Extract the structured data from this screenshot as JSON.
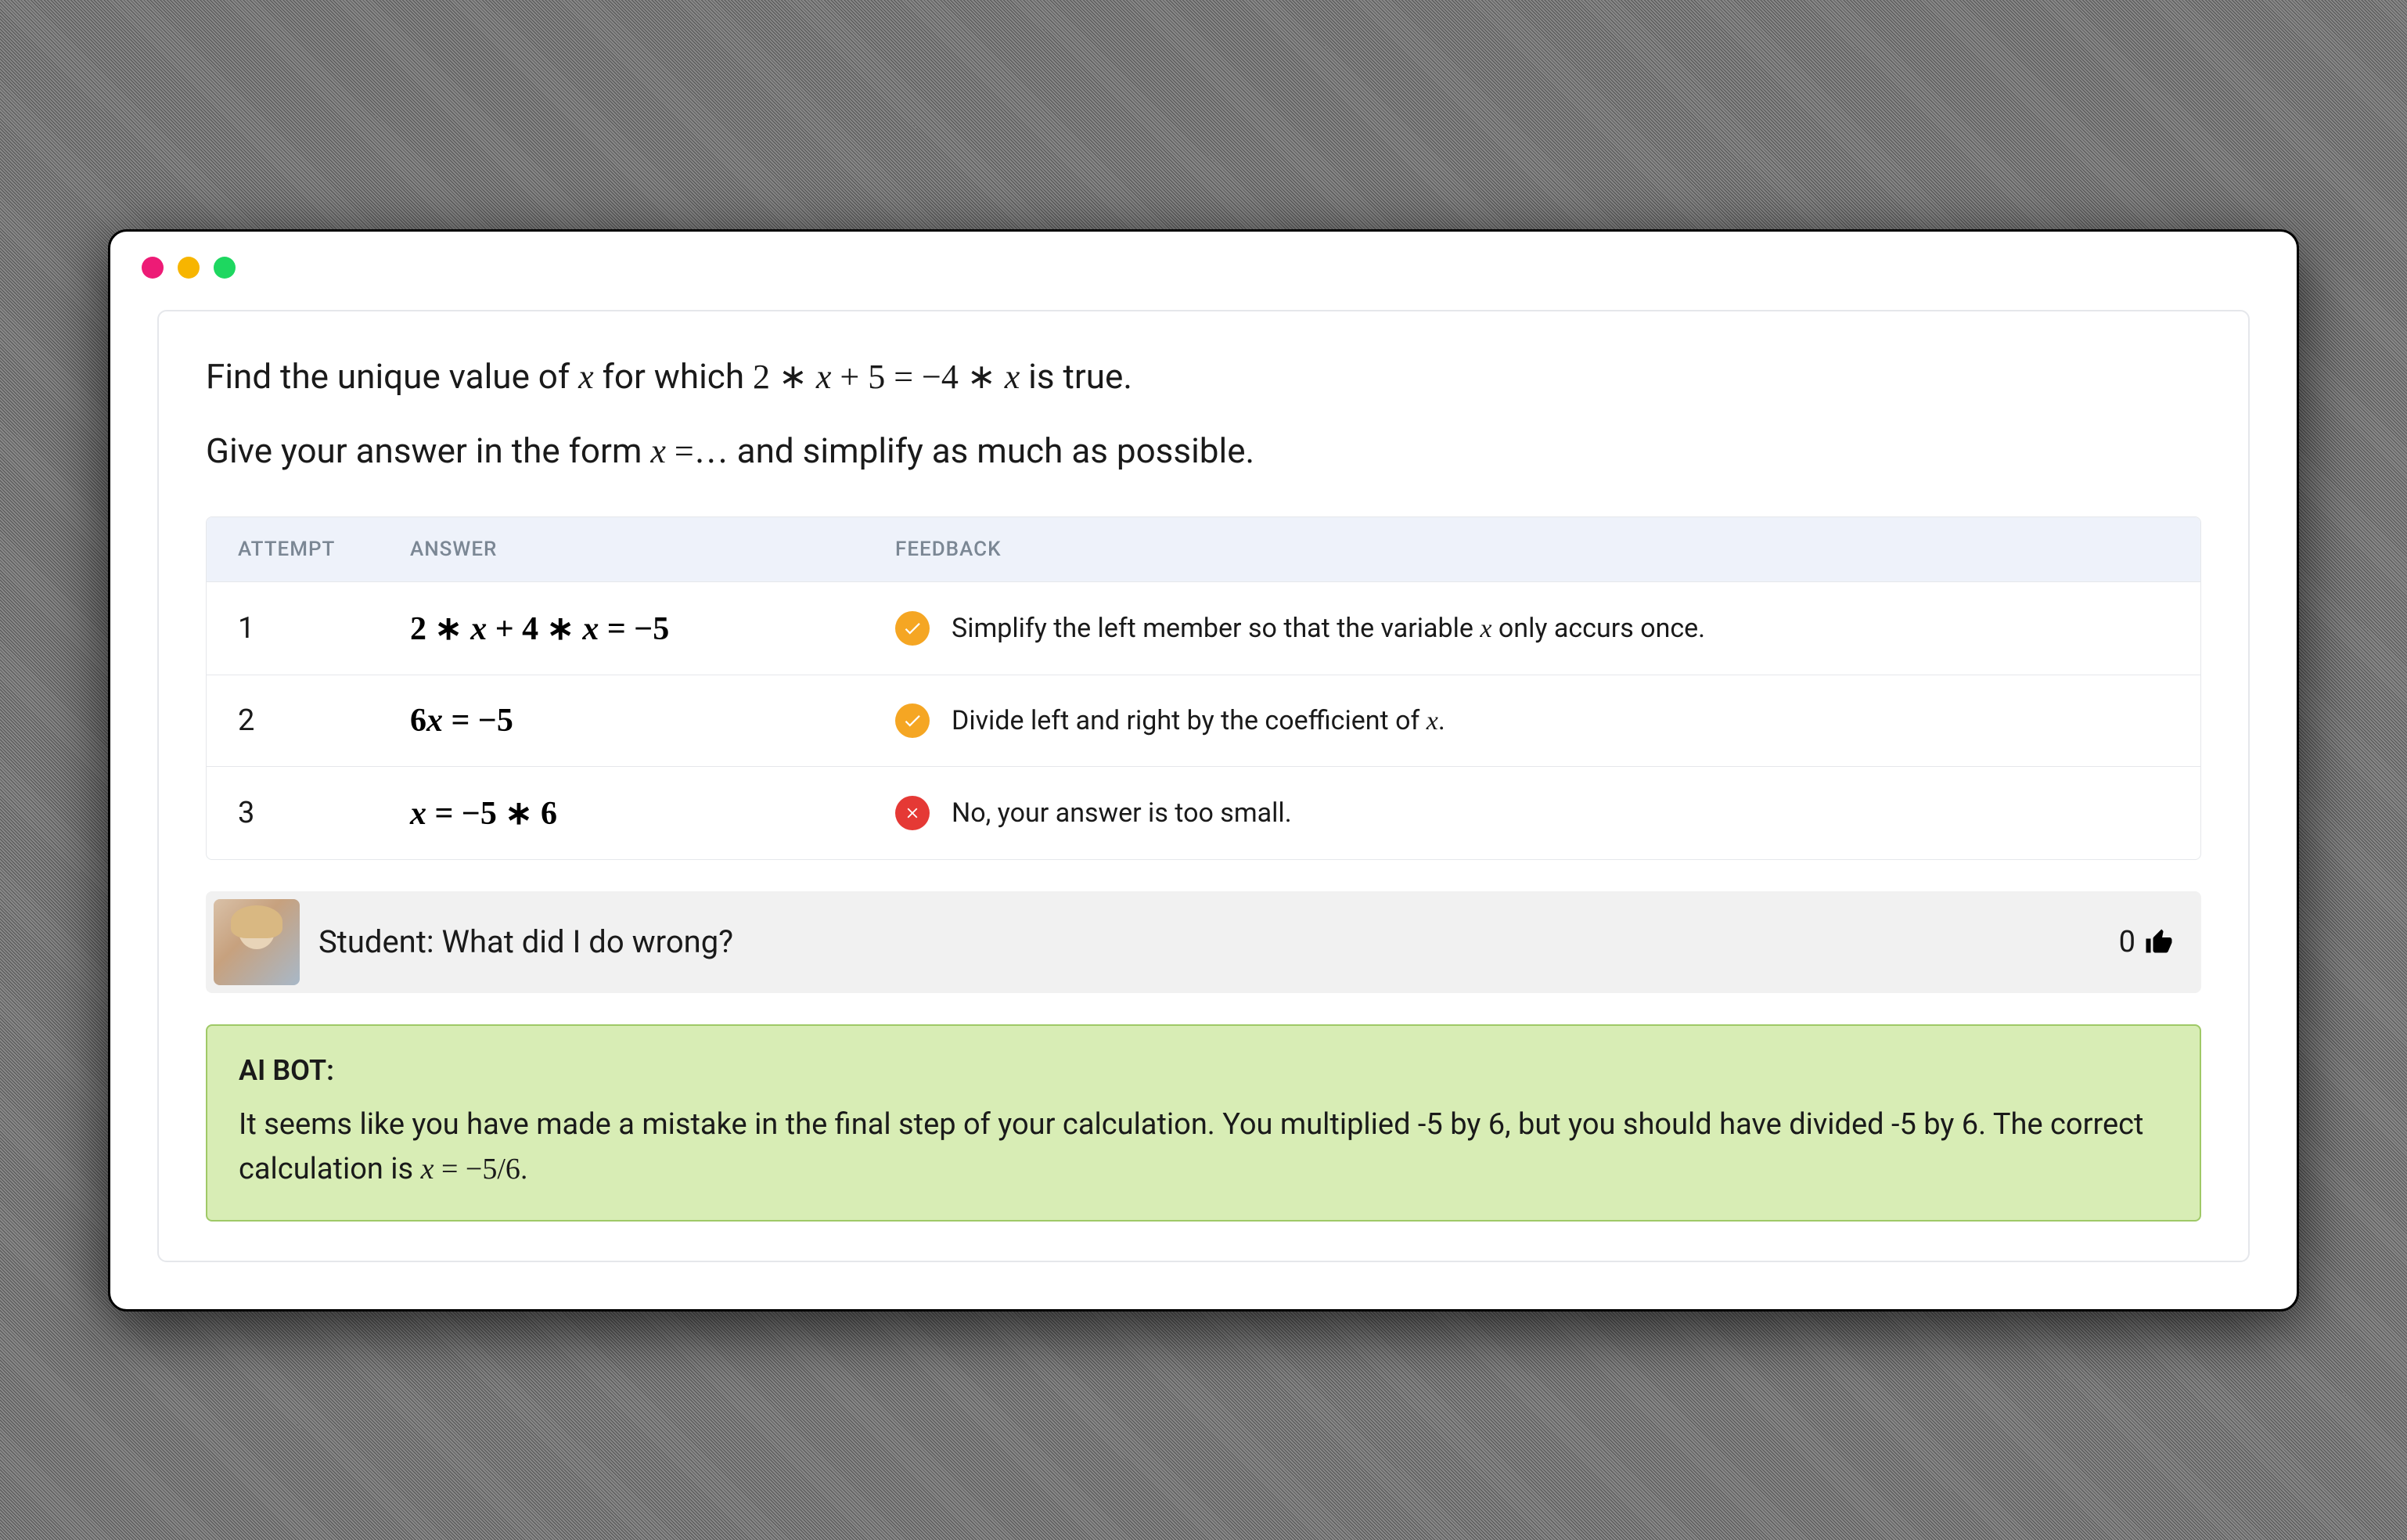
{
  "problem": {
    "line1_before": "Find the unique value of ",
    "line1_var": "x",
    "line1_mid": " for which ",
    "line1_equation": "2 ∗ x + 5 = −4 ∗ x",
    "line1_after": " is true.",
    "line2_before": "Give your answer in the form ",
    "line2_form": "x =…",
    "line2_after": " and simplify as much as possible."
  },
  "table": {
    "headers": {
      "attempt": "ATTEMPT",
      "answer": "ANSWER",
      "feedback": "FEEDBACK"
    },
    "rows": [
      {
        "num": "1",
        "answer": "2 ∗ x + 4 ∗ x = −5",
        "status": "warn",
        "feedback_before": "Simplify the left member so that the variable ",
        "feedback_var": "x",
        "feedback_after": " only accurs once."
      },
      {
        "num": "2",
        "answer": "6x = −5",
        "status": "warn",
        "feedback_before": "Divide left and right by the coefficient of ",
        "feedback_var": "x",
        "feedback_after": "."
      },
      {
        "num": "3",
        "answer": "x = −5 ∗ 6",
        "status": "error",
        "feedback_before": "No, your answer is too small.",
        "feedback_var": "",
        "feedback_after": ""
      }
    ]
  },
  "chat": {
    "student_prefix": "Student: ",
    "student_question": "What did I do wrong?",
    "likes_count": "0"
  },
  "bot": {
    "label": "AI BOT:",
    "text_before": "It seems like you have made a mistake in the final step of your calculation. You multiplied -5 by 6, but you should have divided -5 by 6. The correct calculation is ",
    "text_math": "x = −5/6",
    "text_after": "."
  }
}
